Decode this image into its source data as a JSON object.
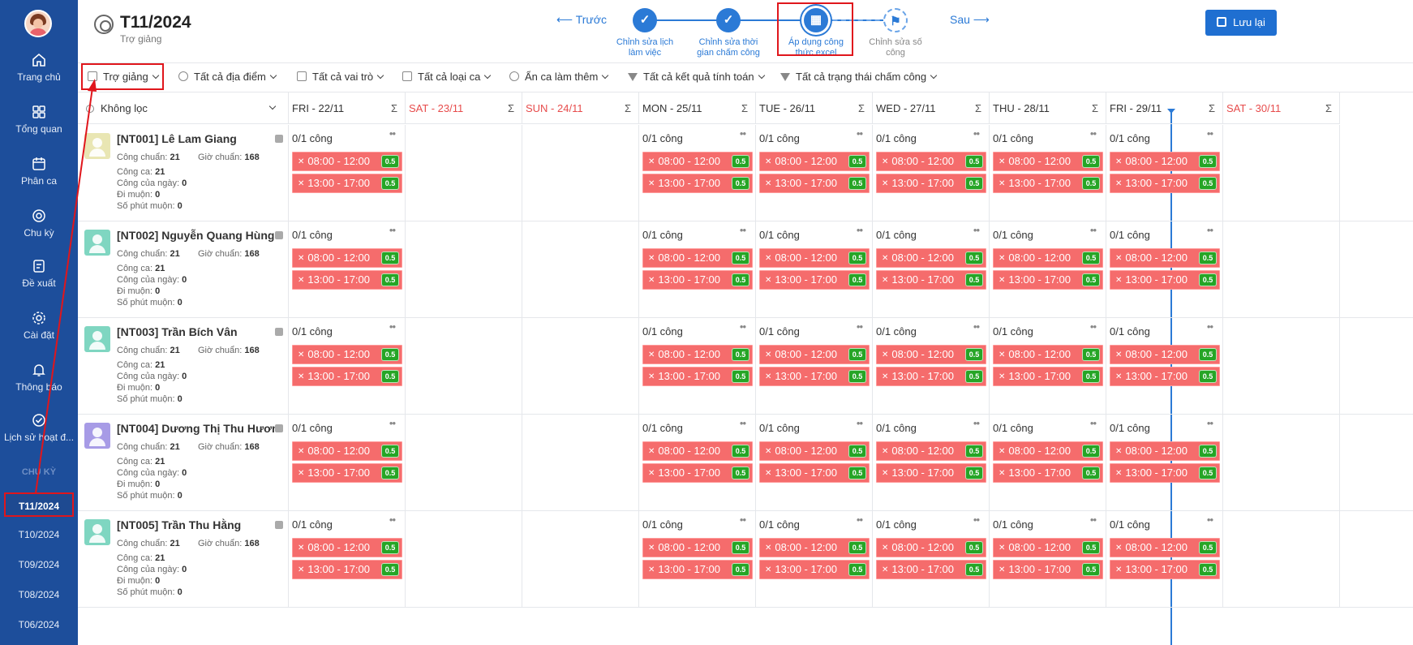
{
  "sidebar": {
    "items": [
      {
        "label": "Trang chủ",
        "icon": "home-icon"
      },
      {
        "label": "Tổng quan",
        "icon": "grid-icon"
      },
      {
        "label": "Phân ca",
        "icon": "calendar-icon"
      },
      {
        "label": "Chu kỳ",
        "icon": "cycle-icon"
      },
      {
        "label": "Đề xuất",
        "icon": "proposal-icon"
      },
      {
        "label": "Cài đặt",
        "icon": "gear-icon"
      },
      {
        "label": "Thông báo",
        "icon": "bell-icon"
      },
      {
        "label": "Lịch sử hoạt đ...",
        "icon": "check-circle-icon"
      }
    ],
    "period_heading": "CHU KỲ",
    "periods": [
      "T11/2024",
      "T10/2024",
      "T09/2024",
      "T08/2024",
      "T06/2024"
    ]
  },
  "header": {
    "title": "T11/2024",
    "subtitle": "Trợ giảng",
    "prev_label": "⟵ Trước",
    "next_label": "Sau ⟶",
    "save_label": "Lưu lại",
    "steps": [
      {
        "label_1": "Chỉnh sửa lịch",
        "label_2": "làm việc",
        "status": "done"
      },
      {
        "label_1": "Chỉnh sửa thời",
        "label_2": "gian chấm công",
        "status": "done"
      },
      {
        "label_1": "Áp dụng công",
        "label_2": "thức excel",
        "status": "current"
      },
      {
        "label_1": "Chỉnh sửa số",
        "label_2": "công",
        "status": "pending"
      }
    ]
  },
  "filters": [
    {
      "label": "Trợ giảng",
      "icon": "calendar-check-icon"
    },
    {
      "label": "Tất cả địa điểm",
      "icon": "location-icon"
    },
    {
      "label": "Tất cả vai trò",
      "icon": "briefcase-icon"
    },
    {
      "label": "Tất cả loại ca",
      "icon": "folder-icon"
    },
    {
      "label": "Ẩn ca làm thêm",
      "icon": "clock-icon"
    },
    {
      "label": "Tất cả kết quả tính toán",
      "icon": "funnel-icon"
    },
    {
      "label": "Tất cả trạng thái chấm công",
      "icon": "funnel-icon"
    }
  ],
  "grid": {
    "filter_label": "Không lọc",
    "sigma": "Σ",
    "columns": [
      {
        "label": "FRI - 22/11",
        "weekend": false
      },
      {
        "label": "SAT - 23/11",
        "weekend": true
      },
      {
        "label": "SUN - 24/11",
        "weekend": true
      },
      {
        "label": "MON - 25/11",
        "weekend": false
      },
      {
        "label": "TUE - 26/11",
        "weekend": false
      },
      {
        "label": "WED - 27/11",
        "weekend": false
      },
      {
        "label": "THU - 28/11",
        "weekend": false
      },
      {
        "label": "FRI - 29/11",
        "weekend": false
      },
      {
        "label": "SAT - 30/11",
        "weekend": true
      }
    ],
    "stat_labels": {
      "standard_work": "Công chuẩn:",
      "standard_hours": "Giờ chuẩn:",
      "shift_work": "Công ca:",
      "day_work": "Công của ngày:",
      "late": "Đi muộn:",
      "late_minutes": "Số phút muộn:"
    },
    "day_count": "0/1 công",
    "dots": "••",
    "shifts": [
      {
        "time": "08:00 - 12:00",
        "coef": "0.5"
      },
      {
        "time": "13:00 - 17:00",
        "coef": "0.5"
      }
    ],
    "employees": [
      {
        "name": "[NT001] Lê Lam Giang",
        "avatar_color": "#e9e6b3",
        "standard_work": "21",
        "standard_hours": "168",
        "shift_work": "21",
        "day_work": "0",
        "late": "0",
        "late_minutes": "0"
      },
      {
        "name": "[NT002] Nguyễn Quang Hùng",
        "avatar_color": "#7fd6c1",
        "standard_work": "21",
        "standard_hours": "168",
        "shift_work": "21",
        "day_work": "0",
        "late": "0",
        "late_minutes": "0"
      },
      {
        "name": "[NT003] Trần Bích Vân",
        "avatar_color": "#7fd6c1",
        "standard_work": "21",
        "standard_hours": "168",
        "shift_work": "21",
        "day_work": "0",
        "late": "0",
        "late_minutes": "0"
      },
      {
        "name": "[NT004] Dương Thị Thu Hương",
        "avatar_color": "#a79be6",
        "standard_work": "21",
        "standard_hours": "168",
        "shift_work": "21",
        "day_work": "0",
        "late": "0",
        "late_minutes": "0"
      },
      {
        "name": "[NT005] Trần Thu Hằng",
        "avatar_color": "#7fd6c1",
        "standard_work": "21",
        "standard_hours": "168",
        "shift_work": "21",
        "day_work": "0",
        "late": "0",
        "late_minutes": "0"
      }
    ]
  },
  "colors": {
    "sidebar": "#1d4e9b",
    "accent": "#2b7ad6",
    "shift": "#f56c6c",
    "coef": "#26a526",
    "highlight": "#e0161c"
  }
}
